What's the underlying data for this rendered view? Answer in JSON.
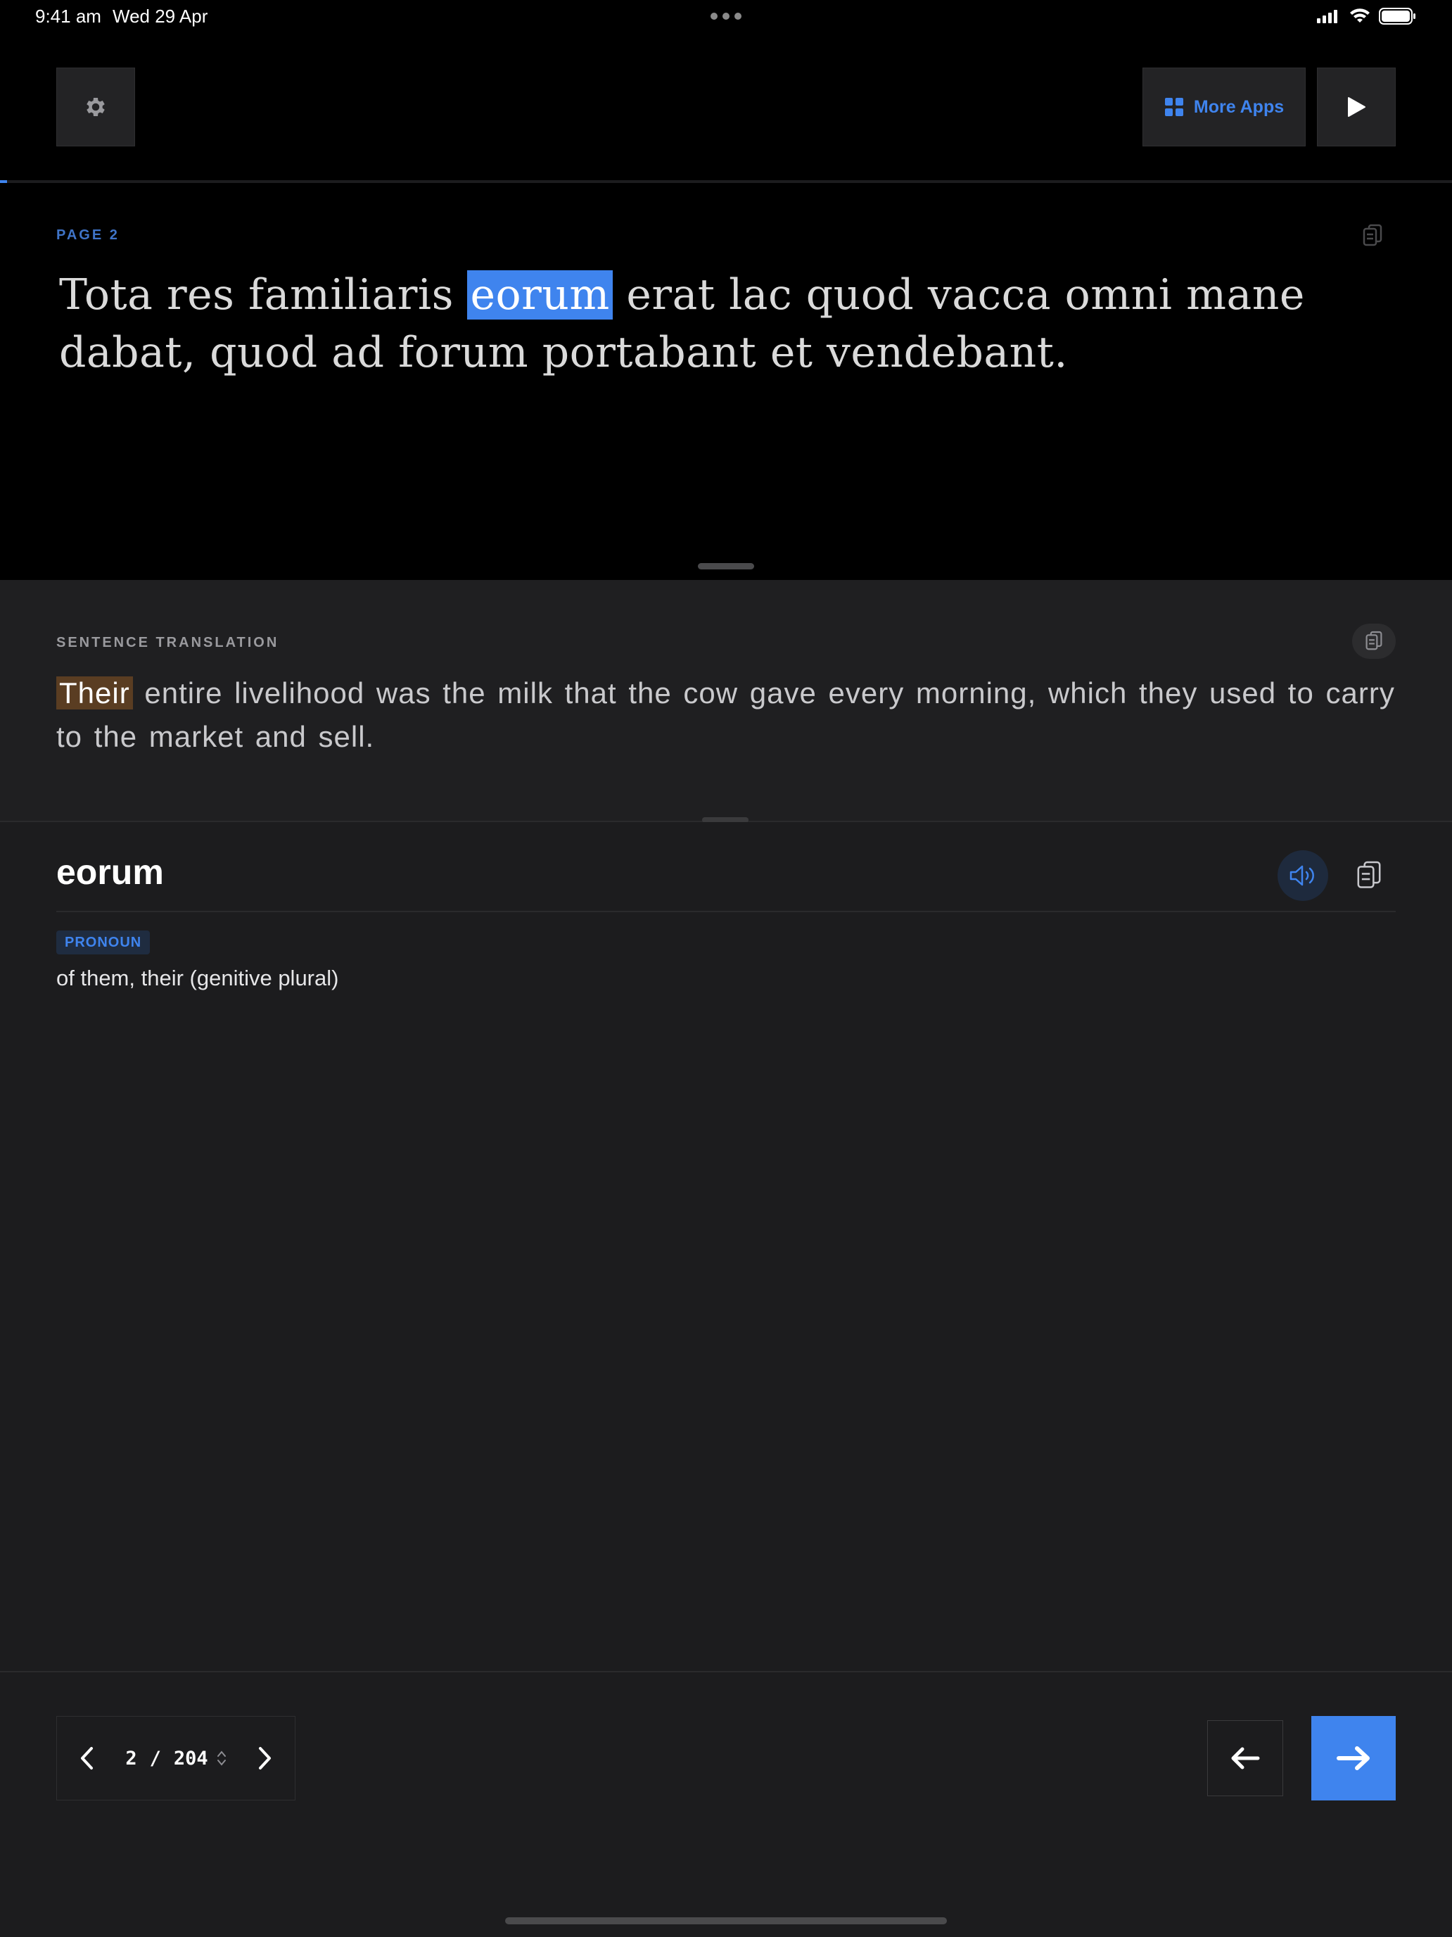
{
  "status_bar": {
    "time": "9:41 am",
    "date": "Wed 29 Apr"
  },
  "toolbar": {
    "more_apps_label": "More Apps",
    "settings_icon": "gear-icon",
    "play_icon": "play-icon",
    "accent_color": "#3f84ee"
  },
  "reader": {
    "page_label": "PAGE 2",
    "progress_fraction": 0.005,
    "latin_words": [
      "Tota",
      "res",
      "familiaris",
      "eorum",
      "erat",
      "lac",
      "quod",
      "vacca",
      "omni",
      "mane",
      "dabat,",
      "quod",
      "ad",
      "forum",
      "portabant",
      "et",
      "vendebant."
    ],
    "highlighted_index": 3
  },
  "translation": {
    "label": "SENTENCE TRANSLATION",
    "highlight": "Their",
    "rest": "entire livelihood was the milk that the cow gave every morning, which they used to carry to the market and sell."
  },
  "dictionary": {
    "word": "eorum",
    "part_of_speech": "PRONOUN",
    "definition": "of them, their (genitive plural)"
  },
  "pager": {
    "current": "2",
    "separator": "/",
    "total": "204"
  }
}
